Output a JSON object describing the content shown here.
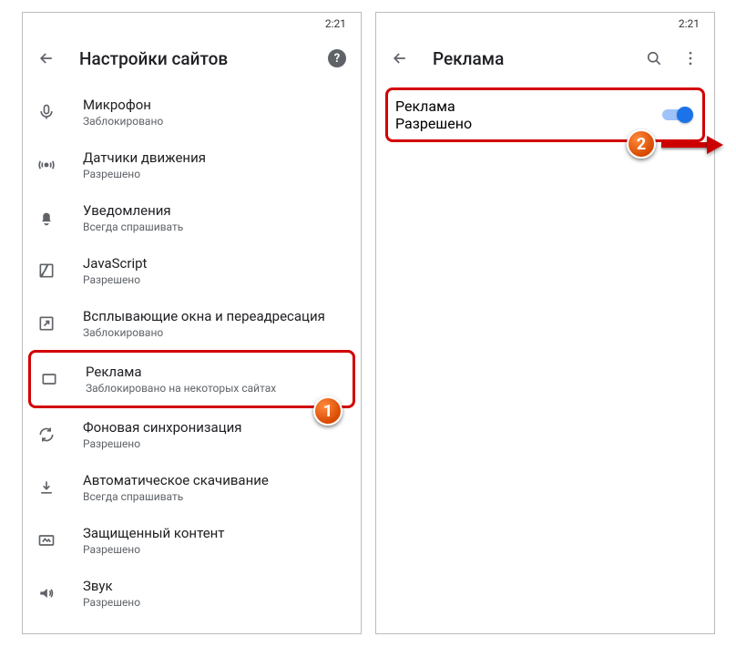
{
  "status_time": "2:21",
  "left": {
    "title": "Настройки сайтов",
    "items": [
      {
        "label": "Микрофон",
        "sub": "Заблокировано"
      },
      {
        "label": "Датчики движения",
        "sub": "Разрешено"
      },
      {
        "label": "Уведомления",
        "sub": "Всегда спрашивать"
      },
      {
        "label": "JavaScript",
        "sub": "Разрешено"
      },
      {
        "label": "Всплывающие окна и переадресация",
        "sub": "Заблокировано"
      },
      {
        "label": "Реклама",
        "sub": "Заблокировано на некоторых сайтах"
      },
      {
        "label": "Фоновая синхронизация",
        "sub": "Разрешено"
      },
      {
        "label": "Автоматическое скачивание",
        "sub": "Всегда спрашивать"
      },
      {
        "label": "Защищенный контент",
        "sub": "Разрешено"
      },
      {
        "label": "Звук",
        "sub": "Разрешено"
      }
    ]
  },
  "right": {
    "title": "Реклама",
    "toggle_label": "Реклама",
    "toggle_sub": "Разрешено",
    "toggle_on": true
  },
  "badges": {
    "one": "1",
    "two": "2"
  }
}
